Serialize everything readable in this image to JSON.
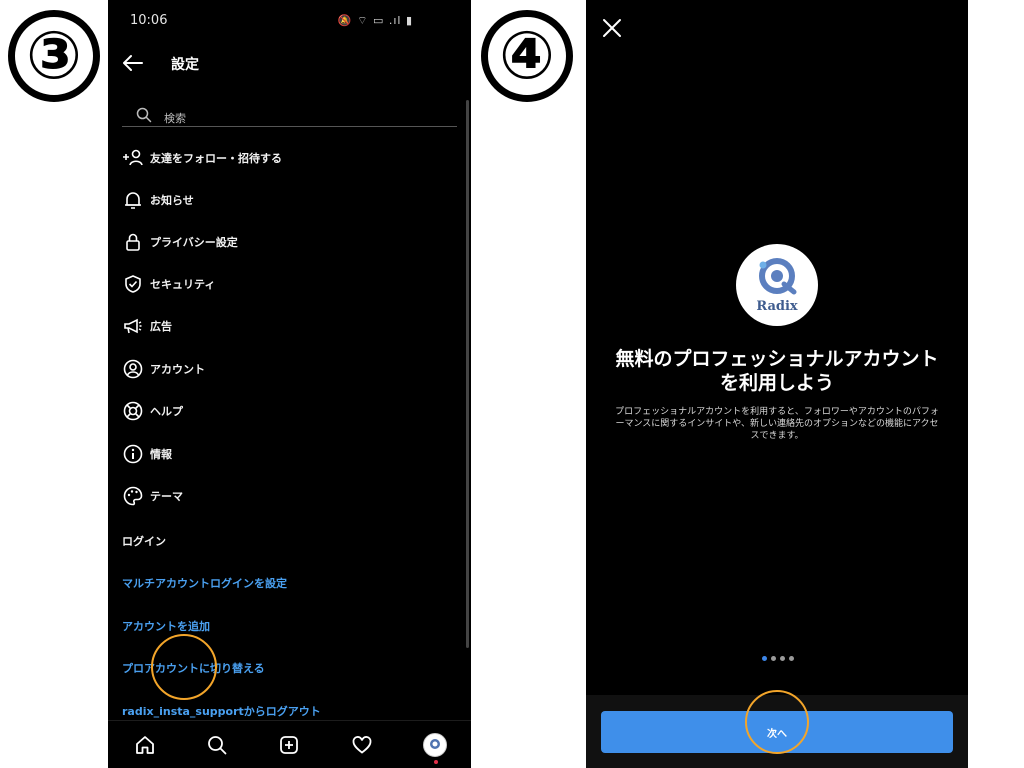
{
  "steps": {
    "left": "③",
    "right": "④"
  },
  "left_phone": {
    "status": {
      "time": "10:06",
      "icons": "🔕 ⌔ ▭ .ıl ▮"
    },
    "header": {
      "title": "設定"
    },
    "search": {
      "placeholder": "検索"
    },
    "menu": [
      {
        "label": "友達をフォロー・招待する",
        "icon": "add-person-icon"
      },
      {
        "label": "お知らせ",
        "icon": "bell-icon"
      },
      {
        "label": "プライバシー設定",
        "icon": "lock-icon"
      },
      {
        "label": "セキュリティ",
        "icon": "shield-check-icon"
      },
      {
        "label": "広告",
        "icon": "megaphone-icon"
      },
      {
        "label": "アカウント",
        "icon": "account-circle-icon"
      },
      {
        "label": "ヘルプ",
        "icon": "lifebuoy-icon"
      },
      {
        "label": "情報",
        "icon": "info-icon"
      },
      {
        "label": "テーマ",
        "icon": "palette-icon"
      }
    ],
    "login_section": "ログイン",
    "links": [
      "マルチアカウントログインを設定",
      "アカウントを追加",
      "プロアカウントに切り替える",
      "radix_insta_supportからログアウト"
    ],
    "nav": [
      "home-icon",
      "search-icon",
      "add-post-icon",
      "heart-icon",
      "profile-avatar"
    ],
    "avatar_label": "Radix"
  },
  "right_phone": {
    "logo_text": "Radix",
    "title_line1": "無料のプロフェッショナルアカウント",
    "title_line2": "を利用しよう",
    "description": "プロフェッショナルアカウントを利用すると、フォロワーやアカウントのパフォーマンスに関するインサイトや、新しい連絡先のオプションなどの機能にアクセスできます。",
    "pager": {
      "count": 4,
      "active": 0
    },
    "next_button": "次へ"
  },
  "colors": {
    "link": "#4aa0f0",
    "button": "#3f8fea",
    "highlight": "#f3a52a",
    "pager_active": "#3d86e8"
  }
}
